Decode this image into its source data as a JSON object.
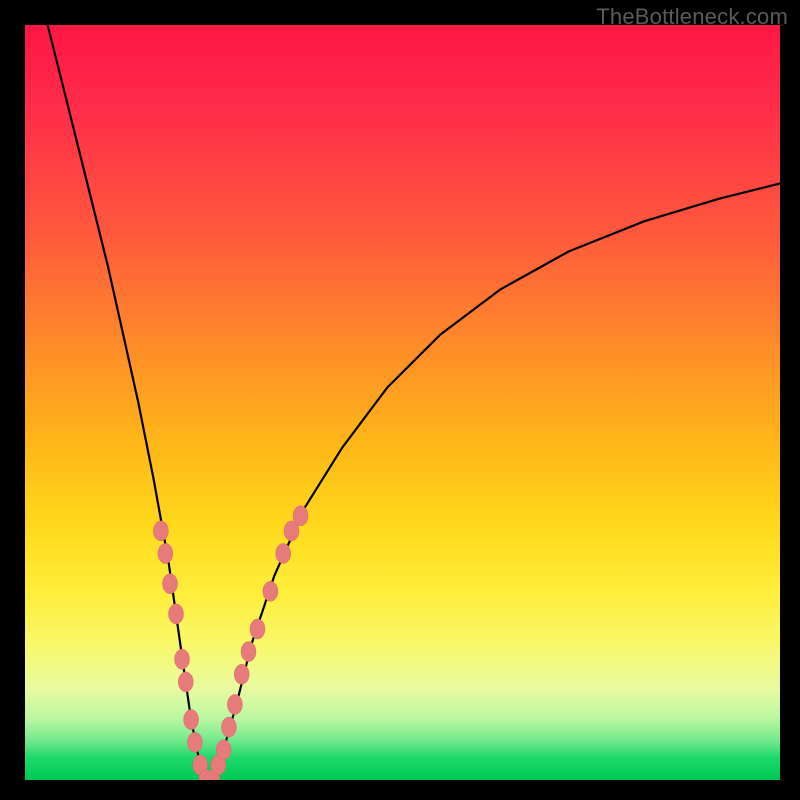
{
  "watermark": {
    "text": "TheBottleneck.com"
  },
  "chart_data": {
    "type": "line",
    "title": "",
    "xlabel": "",
    "ylabel": "",
    "xlim": [
      0,
      100
    ],
    "ylim": [
      0,
      100
    ],
    "series": [
      {
        "name": "bottleneck-curve",
        "x": [
          3,
          5,
          7,
          9,
          11,
          13,
          15,
          17,
          19,
          20,
          21,
          22,
          23,
          24,
          25,
          26,
          28,
          30,
          33,
          37,
          42,
          48,
          55,
          63,
          72,
          82,
          92,
          100
        ],
        "y": [
          100,
          92,
          84,
          76,
          68,
          59,
          50,
          40,
          29,
          22,
          15,
          8,
          3,
          0,
          0,
          3,
          10,
          18,
          27,
          36,
          44,
          52,
          59,
          65,
          70,
          74,
          77,
          79
        ]
      }
    ],
    "markers": [
      {
        "name": "data-point",
        "x": 18.0,
        "y": 33
      },
      {
        "name": "data-point",
        "x": 18.6,
        "y": 30
      },
      {
        "name": "data-point",
        "x": 19.2,
        "y": 26
      },
      {
        "name": "data-point",
        "x": 20.0,
        "y": 22
      },
      {
        "name": "data-point",
        "x": 20.8,
        "y": 16
      },
      {
        "name": "data-point",
        "x": 21.3,
        "y": 13
      },
      {
        "name": "data-point",
        "x": 22.0,
        "y": 8
      },
      {
        "name": "data-point",
        "x": 22.5,
        "y": 5
      },
      {
        "name": "data-point",
        "x": 23.2,
        "y": 2
      },
      {
        "name": "data-point",
        "x": 24.0,
        "y": 0
      },
      {
        "name": "data-point",
        "x": 24.8,
        "y": 0
      },
      {
        "name": "data-point",
        "x": 25.6,
        "y": 2
      },
      {
        "name": "data-point",
        "x": 26.3,
        "y": 4
      },
      {
        "name": "data-point",
        "x": 27.0,
        "y": 7
      },
      {
        "name": "data-point",
        "x": 27.8,
        "y": 10
      },
      {
        "name": "data-point",
        "x": 28.7,
        "y": 14
      },
      {
        "name": "data-point",
        "x": 29.6,
        "y": 17
      },
      {
        "name": "data-point",
        "x": 30.8,
        "y": 20
      },
      {
        "name": "data-point",
        "x": 32.5,
        "y": 25
      },
      {
        "name": "data-point",
        "x": 34.2,
        "y": 30
      },
      {
        "name": "data-point",
        "x": 35.3,
        "y": 33
      },
      {
        "name": "data-point",
        "x": 36.5,
        "y": 35
      }
    ],
    "colors": {
      "curve": "#000000",
      "marker_fill": "#e77b7b",
      "marker_stroke": "#d96868"
    }
  }
}
